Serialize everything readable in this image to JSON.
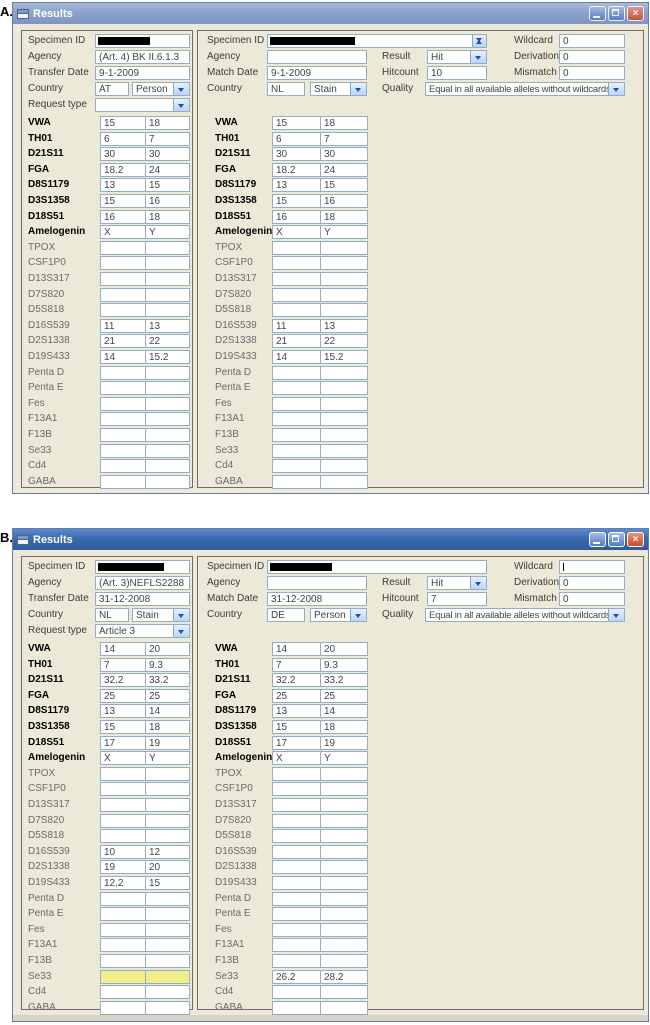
{
  "colors": {
    "titlebar_active": "#3a69ad",
    "titlebar_inactive": "#8ba2cc",
    "content_bg": "#ece9d8",
    "field_border": "#92aec7",
    "close_button": "#cf4a28",
    "highlight_yellow": "#f2ee8d"
  },
  "windows": [
    {
      "figure_label": "A.",
      "title": "Results",
      "active": false,
      "titlebar_buttons": {
        "minimize": "minimize",
        "maximize": "maximize",
        "close": "close"
      },
      "left_panel": {
        "specimen_label": "Specimen ID",
        "redaction_w": 52,
        "agency_label": "Agency",
        "agency": "(Art. 4) BK II.6.1.3",
        "date_label": "Transfer Date",
        "date": "9-1-2009",
        "country_label": "Country",
        "country_code": "AT",
        "country_kind": "Person",
        "request_label": "Request type",
        "request": "",
        "loci": [
          {
            "name": "VWA",
            "bold": true,
            "a1": "15",
            "a2": "18"
          },
          {
            "name": "TH01",
            "bold": true,
            "a1": "6",
            "a2": "7"
          },
          {
            "name": "D21S11",
            "bold": true,
            "a1": "30",
            "a2": "30"
          },
          {
            "name": "FGA",
            "bold": true,
            "a1": "18.2",
            "a2": "24"
          },
          {
            "name": "D8S1179",
            "bold": true,
            "a1": "13",
            "a2": "15"
          },
          {
            "name": "D3S1358",
            "bold": true,
            "a1": "15",
            "a2": "16"
          },
          {
            "name": "D18S51",
            "bold": true,
            "a1": "16",
            "a2": "18"
          },
          {
            "name": "Amelogenin",
            "bold": true,
            "a1": "X",
            "a2": "Y"
          },
          {
            "name": "TPOX",
            "a1": "",
            "a2": ""
          },
          {
            "name": "CSF1P0",
            "a1": "",
            "a2": ""
          },
          {
            "name": "D13S317",
            "a1": "",
            "a2": ""
          },
          {
            "name": "D7S820",
            "a1": "",
            "a2": ""
          },
          {
            "name": "D5S818",
            "a1": "",
            "a2": ""
          },
          {
            "name": "D16S539",
            "a1": "11",
            "a2": "13"
          },
          {
            "name": "D2S1338",
            "a1": "21",
            "a2": "22"
          },
          {
            "name": "D19S433",
            "a1": "14",
            "a2": "15.2"
          },
          {
            "name": "Penta D",
            "a1": "",
            "a2": ""
          },
          {
            "name": "Penta E",
            "a1": "",
            "a2": ""
          },
          {
            "name": "Fes",
            "a1": "",
            "a2": ""
          },
          {
            "name": "F13A1",
            "a1": "",
            "a2": ""
          },
          {
            "name": "F13B",
            "a1": "",
            "a2": ""
          },
          {
            "name": "Se33",
            "a1": "",
            "a2": ""
          },
          {
            "name": "Cd4",
            "a1": "",
            "a2": ""
          },
          {
            "name": "GABA",
            "a1": "",
            "a2": ""
          }
        ]
      },
      "right_panel": {
        "specimen_label": "Specimen ID",
        "redaction_w": 85,
        "spinner": true,
        "agency_label": "Agency",
        "agency": "",
        "date_label": "Match Date",
        "date": "9-1-2009",
        "country_label": "Country",
        "country_code": "NL",
        "country_kind": "Stain",
        "loci": [
          {
            "name": "VWA",
            "bold": true,
            "a1": "15",
            "a2": "18"
          },
          {
            "name": "TH01",
            "bold": true,
            "a1": "6",
            "a2": "7"
          },
          {
            "name": "D21S11",
            "bold": true,
            "a1": "30",
            "a2": "30"
          },
          {
            "name": "FGA",
            "bold": true,
            "a1": "18.2",
            "a2": "24"
          },
          {
            "name": "D8S1179",
            "bold": true,
            "a1": "13",
            "a2": "15"
          },
          {
            "name": "D3S1358",
            "bold": true,
            "a1": "15",
            "a2": "16"
          },
          {
            "name": "D18S51",
            "bold": true,
            "a1": "16",
            "a2": "18"
          },
          {
            "name": "Amelogenin",
            "bold": true,
            "a1": "X",
            "a2": "Y"
          },
          {
            "name": "TPOX",
            "a1": "",
            "a2": ""
          },
          {
            "name": "CSF1P0",
            "a1": "",
            "a2": ""
          },
          {
            "name": "D13S317",
            "a1": "",
            "a2": ""
          },
          {
            "name": "D7S820",
            "a1": "",
            "a2": ""
          },
          {
            "name": "D5S818",
            "a1": "",
            "a2": ""
          },
          {
            "name": "D16S539",
            "a1": "11",
            "a2": "13"
          },
          {
            "name": "D2S1338",
            "a1": "21",
            "a2": "22"
          },
          {
            "name": "D19S433",
            "a1": "14",
            "a2": "15.2"
          },
          {
            "name": "Penta D",
            "a1": "",
            "a2": ""
          },
          {
            "name": "Penta E",
            "a1": "",
            "a2": ""
          },
          {
            "name": "Fes",
            "a1": "",
            "a2": ""
          },
          {
            "name": "F13A1",
            "a1": "",
            "a2": ""
          },
          {
            "name": "F13B",
            "a1": "",
            "a2": ""
          },
          {
            "name": "Se33",
            "a1": "",
            "a2": ""
          },
          {
            "name": "Cd4",
            "a1": "",
            "a2": ""
          },
          {
            "name": "GABA",
            "a1": "",
            "a2": ""
          }
        ]
      },
      "match": {
        "result_label": "Result",
        "result": "Hit",
        "hitcount_label": "Hitcount",
        "hitcount": "10",
        "quality_label": "Quality",
        "quality": "Equal in all available alleles without wildcards",
        "wildcard_label": "Wildcard",
        "wildcard": "0",
        "wildcard_cursor": false,
        "derivation_label": "Derivation",
        "derivation": "0",
        "mismatch_label": "Mismatch",
        "mismatch": "0"
      }
    },
    {
      "figure_label": "B.",
      "title": "Results",
      "active": true,
      "titlebar_buttons": {
        "minimize": "minimize",
        "maximize": "maximize",
        "close": "close"
      },
      "left_panel": {
        "specimen_label": "Specimen ID",
        "redaction_w": 66,
        "agency_label": "Agency",
        "agency": "(Art. 3)NEFLS2288",
        "date_label": "Transfer Date",
        "date": "31-12-2008",
        "country_label": "Country",
        "country_code": "NL",
        "country_kind": "Stain",
        "request_label": "Request type",
        "request": "Article 3",
        "loci": [
          {
            "name": "VWA",
            "bold": true,
            "a1": "14",
            "a2": "20"
          },
          {
            "name": "TH01",
            "bold": true,
            "a1": "7",
            "a2": "9.3"
          },
          {
            "name": "D21S11",
            "bold": true,
            "a1": "32.2",
            "a2": "33.2"
          },
          {
            "name": "FGA",
            "bold": true,
            "a1": "25",
            "a2": "25"
          },
          {
            "name": "D8S1179",
            "bold": true,
            "a1": "13",
            "a2": "14"
          },
          {
            "name": "D3S1358",
            "bold": true,
            "a1": "15",
            "a2": "18"
          },
          {
            "name": "D18S51",
            "bold": true,
            "a1": "17",
            "a2": "19"
          },
          {
            "name": "Amelogenin",
            "bold": true,
            "a1": "X",
            "a2": "Y"
          },
          {
            "name": "TPOX",
            "a1": "",
            "a2": ""
          },
          {
            "name": "CSF1P0",
            "a1": "",
            "a2": ""
          },
          {
            "name": "D13S317",
            "a1": "",
            "a2": ""
          },
          {
            "name": "D7S820",
            "a1": "",
            "a2": ""
          },
          {
            "name": "D5S818",
            "a1": "",
            "a2": ""
          },
          {
            "name": "D16S539",
            "a1": "10",
            "a2": "12"
          },
          {
            "name": "D2S1338",
            "a1": "19",
            "a2": "20"
          },
          {
            "name": "D19S433",
            "a1": "12.2",
            "a2": "15"
          },
          {
            "name": "Penta D",
            "a1": "",
            "a2": ""
          },
          {
            "name": "Penta E",
            "a1": "",
            "a2": ""
          },
          {
            "name": "Fes",
            "a1": "",
            "a2": ""
          },
          {
            "name": "F13A1",
            "a1": "",
            "a2": ""
          },
          {
            "name": "F13B",
            "a1": "",
            "a2": ""
          },
          {
            "name": "Se33",
            "a1": "",
            "a2": "",
            "highlight": true
          },
          {
            "name": "Cd4",
            "a1": "",
            "a2": ""
          },
          {
            "name": "GABA",
            "a1": "",
            "a2": ""
          }
        ]
      },
      "right_panel": {
        "specimen_label": "Specimen ID",
        "redaction_w": 62,
        "spinner": false,
        "agency_label": "Agency",
        "agency": "",
        "date_label": "Match Date",
        "date": "31-12-2008",
        "country_label": "Country",
        "country_code": "DE",
        "country_kind": "Person",
        "loci": [
          {
            "name": "VWA",
            "bold": true,
            "a1": "14",
            "a2": "20"
          },
          {
            "name": "TH01",
            "bold": true,
            "a1": "7",
            "a2": "9.3"
          },
          {
            "name": "D21S11",
            "bold": true,
            "a1": "32.2",
            "a2": "33.2"
          },
          {
            "name": "FGA",
            "bold": true,
            "a1": "25",
            "a2": "25"
          },
          {
            "name": "D8S1179",
            "bold": true,
            "a1": "13",
            "a2": "14"
          },
          {
            "name": "D3S1358",
            "bold": true,
            "a1": "15",
            "a2": "18"
          },
          {
            "name": "D18S51",
            "bold": true,
            "a1": "17",
            "a2": "19"
          },
          {
            "name": "Amelogenin",
            "bold": true,
            "a1": "X",
            "a2": "Y"
          },
          {
            "name": "TPOX",
            "a1": "",
            "a2": ""
          },
          {
            "name": "CSF1P0",
            "a1": "",
            "a2": ""
          },
          {
            "name": "D13S317",
            "a1": "",
            "a2": ""
          },
          {
            "name": "D7S820",
            "a1": "",
            "a2": ""
          },
          {
            "name": "D5S818",
            "a1": "",
            "a2": ""
          },
          {
            "name": "D16S539",
            "a1": "",
            "a2": ""
          },
          {
            "name": "D2S1338",
            "a1": "",
            "a2": ""
          },
          {
            "name": "D19S433",
            "a1": "",
            "a2": ""
          },
          {
            "name": "Penta D",
            "a1": "",
            "a2": ""
          },
          {
            "name": "Penta E",
            "a1": "",
            "a2": ""
          },
          {
            "name": "Fes",
            "a1": "",
            "a2": ""
          },
          {
            "name": "F13A1",
            "a1": "",
            "a2": ""
          },
          {
            "name": "F13B",
            "a1": "",
            "a2": ""
          },
          {
            "name": "Se33",
            "a1": "26.2",
            "a2": "28.2"
          },
          {
            "name": "Cd4",
            "a1": "",
            "a2": ""
          },
          {
            "name": "GABA",
            "a1": "",
            "a2": ""
          }
        ]
      },
      "match": {
        "result_label": "Result",
        "result": "Hit",
        "hitcount_label": "Hitcount",
        "hitcount": "7",
        "quality_label": "Quality",
        "quality": "Equal in all available alleles without wildcards",
        "wildcard_label": "Wildcard",
        "wildcard": "",
        "wildcard_cursor": true,
        "derivation_label": "Derivation",
        "derivation": "0",
        "mismatch_label": "Mismatch",
        "mismatch": "0"
      }
    }
  ]
}
